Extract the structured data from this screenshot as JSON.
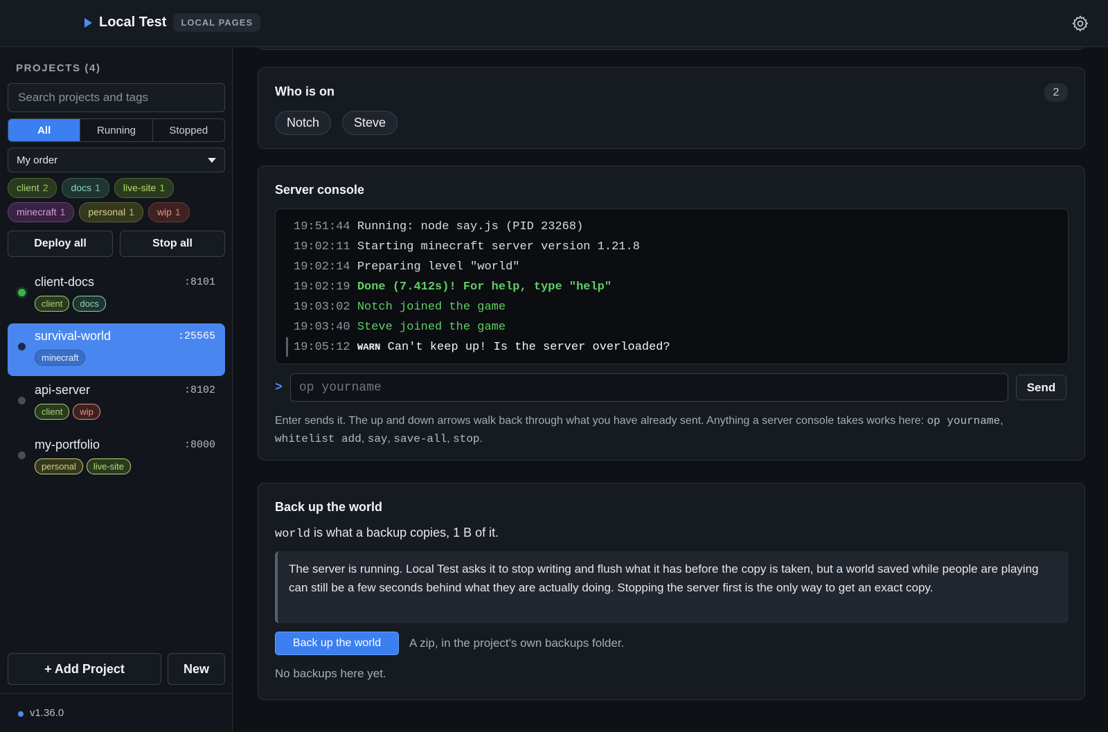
{
  "app": {
    "title": "Local Test",
    "badge": "LOCAL PAGES"
  },
  "sidebar": {
    "heading": "PROJECTS (4)",
    "search_placeholder": "Search projects and tags",
    "filters": [
      "All",
      "Running",
      "Stopped"
    ],
    "active_filter": "All",
    "sort_value": "My order",
    "tags": [
      {
        "name": "client",
        "count": "2"
      },
      {
        "name": "docs",
        "count": "1"
      },
      {
        "name": "live-site",
        "count": "1"
      },
      {
        "name": "minecraft",
        "count": "1"
      },
      {
        "name": "personal",
        "count": "1"
      },
      {
        "name": "wip",
        "count": "1"
      }
    ],
    "deploy_all": "Deploy all",
    "stop_all": "Stop all",
    "projects": [
      {
        "name": "client-docs",
        "port": ":8101",
        "status": "running",
        "tags": [
          "client",
          "docs"
        ]
      },
      {
        "name": "survival-world",
        "port": ":25565",
        "status": "selected",
        "tags": [
          "minecraft"
        ]
      },
      {
        "name": "api-server",
        "port": ":8102",
        "status": "stopped",
        "tags": [
          "client",
          "wip"
        ]
      },
      {
        "name": "my-portfolio",
        "port": ":8000",
        "status": "stopped",
        "tags": [
          "personal",
          "live-site"
        ]
      }
    ],
    "add_project": "+ Add Project",
    "new": "New",
    "version": "v1.36.0"
  },
  "who": {
    "title": "Who is on",
    "count": "2",
    "players": [
      "Notch",
      "Steve"
    ]
  },
  "console": {
    "title": "Server console",
    "lines": [
      {
        "time": "19:51:44",
        "text": "Running: node say.js (PID 23268)",
        "kind": "normal"
      },
      {
        "time": "19:02:11",
        "text": "Starting minecraft server version 1.21.8",
        "kind": "normal"
      },
      {
        "time": "19:02:14",
        "text": "Preparing level \"world\"",
        "kind": "normal"
      },
      {
        "time": "19:02:19",
        "text": "Done (7.412s)! For help, type \"help\"",
        "kind": "done"
      },
      {
        "time": "19:03:02",
        "text": "Notch joined the game",
        "kind": "join"
      },
      {
        "time": "19:03:40",
        "text": "Steve joined the game",
        "kind": "join"
      },
      {
        "time": "19:05:12",
        "tag": "WARN",
        "text": "Can't keep up! Is the server overloaded?",
        "kind": "warn"
      }
    ],
    "prompt": ">",
    "input_placeholder": "op yourname",
    "send": "Send",
    "help_prefix": "Enter sends it. The up and down arrows walk back through what you have already sent. Anything a server console takes works here: ",
    "help_cmds": [
      "op yourname",
      "whitelist add",
      "say",
      "save-all",
      "stop"
    ],
    "help_suffix": "."
  },
  "backup": {
    "title": "Back up the world",
    "world": "world",
    "desc": " is what a backup copies, 1 B of it.",
    "note": "The server is running. Local Test asks it to stop writing and flush what it has before the copy is taken, but a world saved while people are playing can still be a few seconds behind what they are actually doing. Stopping the server first is the only way to get an exact copy.",
    "button": "Back up the world",
    "hint": "A zip, in the project's own backups folder.",
    "empty": "No backups here yet."
  }
}
